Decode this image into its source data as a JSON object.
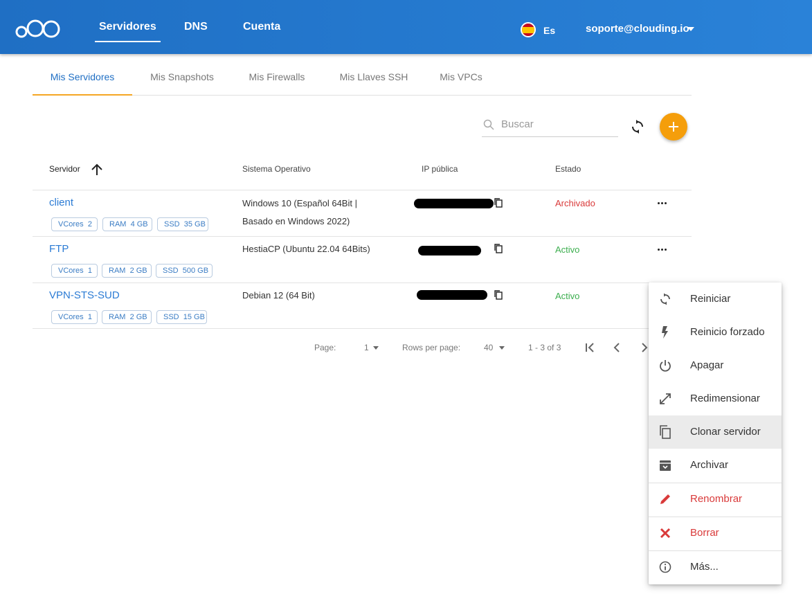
{
  "nav": {
    "items": [
      "Servidores",
      "DNS",
      "Cuenta"
    ],
    "lang": "Es",
    "account": "soporte@clouding.io"
  },
  "tabs": [
    "Mis Servidores",
    "Mis Snapshots",
    "Mis Firewalls",
    "Mis Llaves SSH",
    "Mis VPCs"
  ],
  "search": {
    "placeholder": "Buscar"
  },
  "table": {
    "headers": [
      "Servidor",
      "Sistema Operativo",
      "IP pública",
      "Estado"
    ],
    "rows": [
      {
        "name": "client",
        "vcores_label": "VCores",
        "vcores": "2",
        "ram_label": "RAM",
        "ram": "4 GB",
        "ssd_label": "SSD",
        "ssd": "35 GB",
        "os_line1": "Windows 10 (Español 64Bit |",
        "os_line2": "Basado en Windows 2022)",
        "status": "Archivado",
        "status_color": "#d93a3a"
      },
      {
        "name": "FTP",
        "vcores_label": "VCores",
        "vcores": "1",
        "ram_label": "RAM",
        "ram": "2 GB",
        "ssd_label": "SSD",
        "ssd": "500 GB",
        "os_line1": "HestiaCP (Ubuntu 22.04 64Bits)",
        "status": "Activo",
        "status_color": "#3cae4e"
      },
      {
        "name": "VPN-STS-SUD",
        "vcores_label": "VCores",
        "vcores": "1",
        "ram_label": "RAM",
        "ram": "2 GB",
        "ssd_label": "SSD",
        "ssd": "15 GB",
        "os_line1": "Debian 12 (64 Bit)",
        "status": "Activo",
        "status_color": "#3cae4e"
      }
    ]
  },
  "pagination": {
    "page_label": "Page:",
    "page": "1",
    "rows_label": "Rows per page:",
    "rows": "40",
    "range": "1 - 3 of 3"
  },
  "menu": {
    "items": [
      {
        "label": "Reiniciar",
        "icon": "refresh-icon"
      },
      {
        "label": "Reinicio forzado",
        "icon": "bolt-icon"
      },
      {
        "label": "Apagar",
        "icon": "power-icon"
      },
      {
        "label": "Redimensionar",
        "icon": "resize-icon"
      },
      {
        "label": "Clonar servidor",
        "icon": "copy-icon"
      },
      {
        "label": "Archivar",
        "icon": "archive-icon"
      },
      {
        "label": "Renombrar",
        "icon": "pencil-icon"
      },
      {
        "label": "Borrar",
        "icon": "x-icon"
      },
      {
        "label": "Más...",
        "icon": "info-icon"
      }
    ]
  },
  "colors": {
    "header_blue": "#1f6fc4",
    "accent_orange": "#f59e0b",
    "link_blue": "#2b7bd4",
    "danger_red": "#d93a3a",
    "success_green": "#3cae4e"
  }
}
